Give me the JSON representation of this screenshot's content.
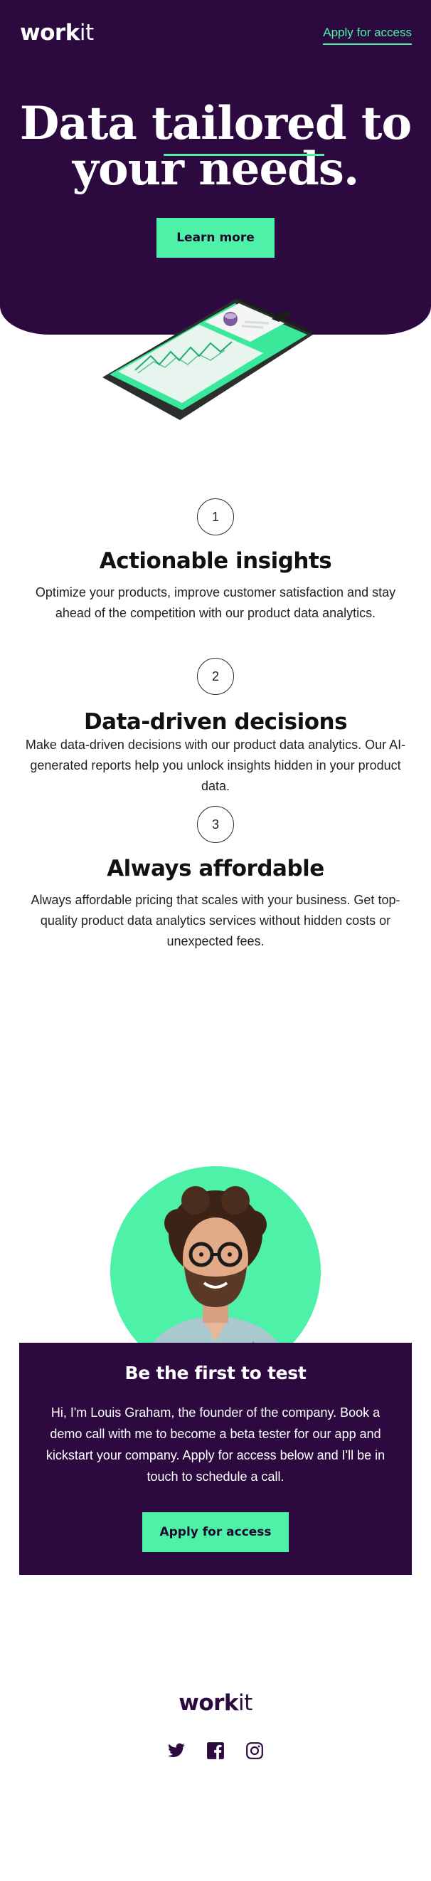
{
  "header": {
    "logo_bold": "work",
    "logo_light": "it",
    "nav_link": "Apply for access"
  },
  "hero": {
    "title_line1": "Data tailored to",
    "title_line2": "your needs.",
    "cta": "Learn more"
  },
  "features": [
    {
      "number": "1",
      "title": "Actionable insights",
      "text": "Optimize your products, improve customer satisfaction and stay ahead of the competition with our product data analytics."
    },
    {
      "number": "2",
      "title": "Data-driven decisions",
      "text": "Make data-driven decisions with our product data analytics. Our AI-generated reports help you unlock insights hidden in your product data."
    },
    {
      "number": "3",
      "title": "Always affordable",
      "text": "Always affordable pricing that scales with your business. Get top-quality product data analytics services without hidden costs or unexpected fees."
    }
  ],
  "founder": {
    "title": "Be the first to test",
    "text": "Hi, I'm Louis Graham, the founder of the company. Book a demo call with me to become a beta tester for our app and kickstart your company. Apply for access below and I'll be in touch to schedule a call.",
    "cta": "Apply for access"
  },
  "footer": {
    "logo_bold": "work",
    "logo_light": "it",
    "socials": [
      "twitter-icon",
      "facebook-icon",
      "instagram-icon"
    ]
  },
  "colors": {
    "primary_dark": "#2c0a3f",
    "accent": "#4df2a8",
    "light_bg": "#fbf7ff"
  }
}
